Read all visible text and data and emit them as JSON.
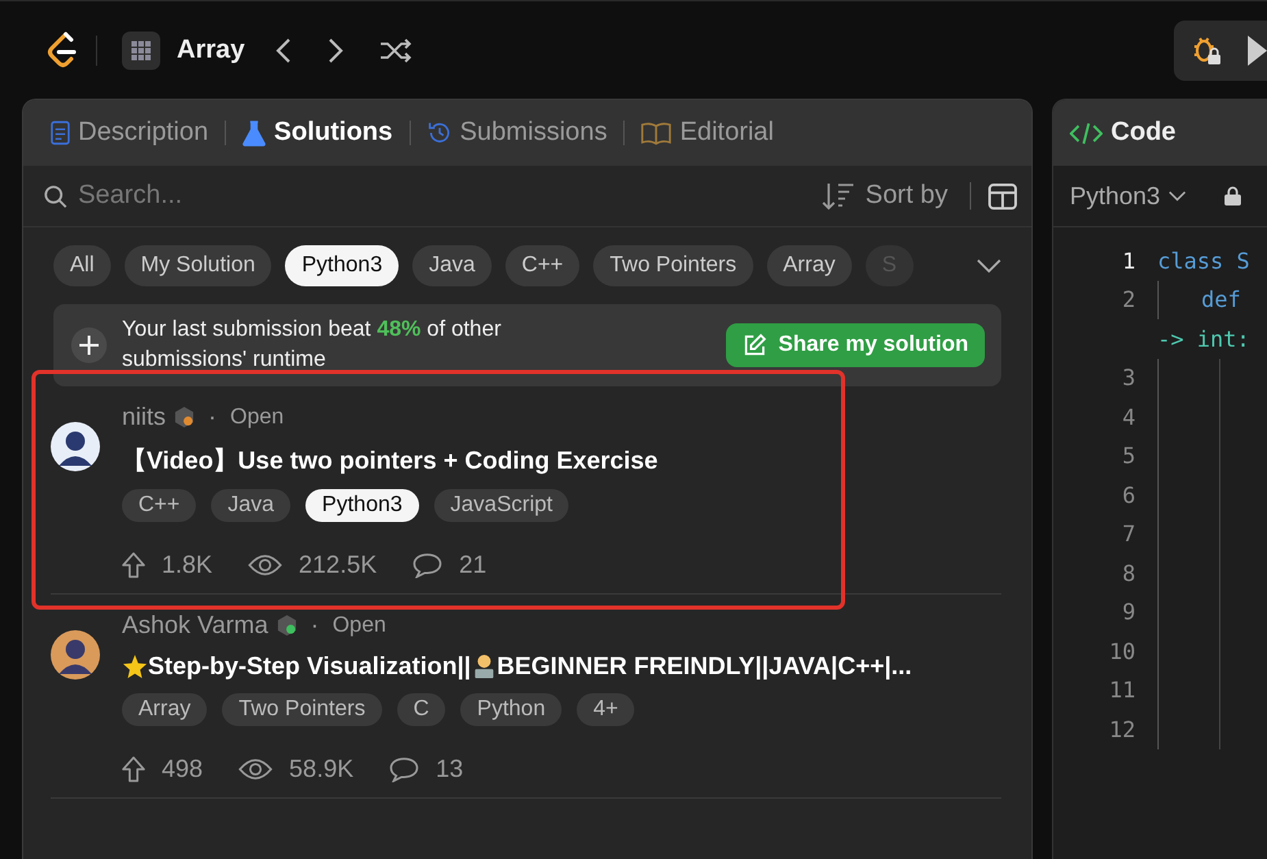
{
  "topbar": {
    "problem_list": "Array"
  },
  "tabs": [
    {
      "label": "Description",
      "selected": false
    },
    {
      "label": "Solutions",
      "selected": true
    },
    {
      "label": "Submissions",
      "selected": false
    },
    {
      "label": "Editorial",
      "selected": false
    }
  ],
  "search": {
    "placeholder": "Search..."
  },
  "sort": {
    "label": "Sort by"
  },
  "filters": [
    {
      "label": "All",
      "selected": false
    },
    {
      "label": "My Solution",
      "selected": false
    },
    {
      "label": "Python3",
      "selected": true
    },
    {
      "label": "Java",
      "selected": false
    },
    {
      "label": "C++",
      "selected": false
    },
    {
      "label": "Two Pointers",
      "selected": false
    },
    {
      "label": "Array",
      "selected": false
    },
    {
      "label": "S",
      "selected": false
    }
  ],
  "banner": {
    "text": "Your last submission beat **48%** of other submissions' runtime",
    "button": "Share my solution"
  },
  "solutions": [
    {
      "author": "niits",
      "separator": "·",
      "status": "Open",
      "highlighted": true,
      "title_parts": [
        {
          "kind": "text",
          "text": "【Video】Use two pointers + Coding Exercise"
        }
      ],
      "tags": [
        {
          "label": "C++",
          "selected": false
        },
        {
          "label": "Java",
          "selected": false
        },
        {
          "label": "Python3",
          "selected": true
        },
        {
          "label": "JavaScript",
          "selected": false
        }
      ],
      "votes": "1.8K",
      "views": "212.5K",
      "comments": "21"
    },
    {
      "author": "Ashok Varma",
      "separator": "·",
      "status": "Open",
      "highlighted": false,
      "title_parts": [
        {
          "kind": "star"
        },
        {
          "kind": "text",
          "text": "Step-by-Step Visualization||"
        },
        {
          "kind": "coder"
        },
        {
          "kind": "text",
          "text": " BEGINNER FREINDLY||JAVA|C++|..."
        }
      ],
      "tags": [
        {
          "label": "Array",
          "selected": false
        },
        {
          "label": "Two Pointers",
          "selected": false
        },
        {
          "label": "C",
          "selected": false
        },
        {
          "label": "Python",
          "selected": false
        },
        {
          "label": "4+",
          "selected": false
        }
      ],
      "votes": "498",
      "views": "58.9K",
      "comments": "13"
    }
  ],
  "code_panel": {
    "title": "Code",
    "language": "Python3",
    "lines": [
      {
        "number": "1",
        "current": true,
        "text": "class S",
        "kind": "class"
      },
      {
        "number": "2",
        "current": false,
        "text": "def",
        "kind": "def"
      },
      {
        "text": "-> int:",
        "kind": "wrap"
      },
      {
        "number": "3",
        "current": false,
        "kind": "blank"
      },
      {
        "number": "4",
        "current": false,
        "kind": "blank"
      },
      {
        "number": "5",
        "current": false,
        "kind": "blank"
      },
      {
        "number": "6",
        "current": false,
        "kind": "blank"
      },
      {
        "number": "7",
        "current": false,
        "kind": "blank"
      },
      {
        "number": "8",
        "current": false,
        "kind": "blank"
      },
      {
        "number": "9",
        "current": false,
        "kind": "blank"
      },
      {
        "number": "10",
        "current": false,
        "kind": "blank"
      },
      {
        "number": "11",
        "current": false,
        "kind": "blank"
      },
      {
        "number": "12",
        "current": false,
        "kind": "blank"
      }
    ]
  }
}
